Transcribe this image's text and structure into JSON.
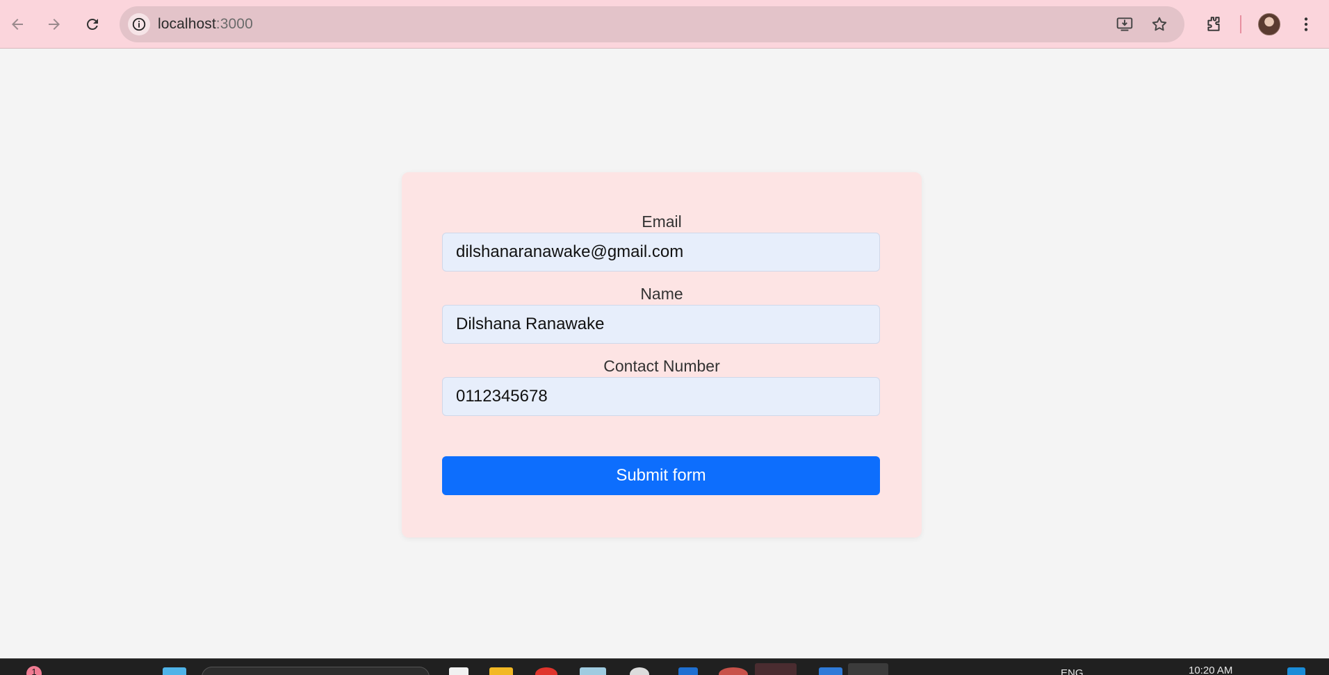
{
  "browser": {
    "url_host": "localhost",
    "url_port": ":3000",
    "icons": {
      "back": "back-arrow-icon",
      "forward": "forward-arrow-icon",
      "reload": "reload-icon",
      "site_info": "info-icon",
      "install": "install-app-icon",
      "bookmark": "star-icon",
      "extensions": "puzzle-icon",
      "menu": "kebab-menu-icon"
    }
  },
  "form": {
    "email_label": "Email",
    "email_value": "dilshanaranawake@gmail.com",
    "name_label": "Name",
    "name_value": "Dilshana Ranawake",
    "contact_label": "Contact Number",
    "contact_value": "0112345678",
    "submit_label": "Submit form"
  },
  "taskbar": {
    "notification_count": "1",
    "language": "ENG",
    "time": "10:20 AM"
  },
  "colors": {
    "browser_frame": "#fbd5dc",
    "card_background": "#fde4e4",
    "input_background": "#e7eefb",
    "submit_button": "#0d6efd",
    "page_background": "#f4f4f4"
  }
}
